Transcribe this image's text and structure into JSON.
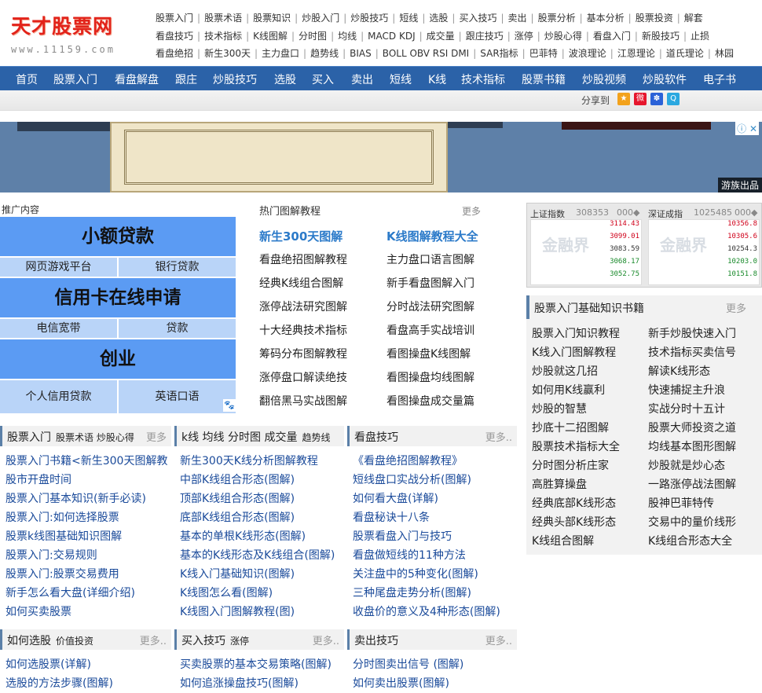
{
  "site": {
    "logo_text": "天才股票网",
    "logo_url": "www.11159.com"
  },
  "top_links": {
    "row1": [
      "股票入门",
      "股票术语",
      "股票知识",
      "炒股入门",
      "炒股技巧",
      "短线",
      "选股",
      "买入技巧",
      "卖出",
      "股票分析",
      "基本分析",
      "股票投资",
      "解套"
    ],
    "row2": [
      "看盘技巧",
      "技术指标",
      "K线图解",
      "分时图",
      "均线",
      "MACD KDJ",
      "成交量",
      "跟庄技巧",
      "涨停",
      "炒股心得",
      "看盘入门",
      "新股技巧",
      "止损"
    ],
    "row3": [
      "看盘绝招",
      "新生300天",
      "主力盘口",
      "趋势线",
      "BIAS",
      "BOLL OBV RSI DMI",
      "SAR指标",
      "巴菲特",
      "波浪理论",
      "江恩理论",
      "道氏理论",
      "林园"
    ]
  },
  "nav": [
    "首页",
    "股票入门",
    "看盘解盘",
    "跟庄",
    "炒股技巧",
    "选股",
    "买入",
    "卖出",
    "短线",
    "K线",
    "技术指标",
    "股票书籍",
    "炒股视频",
    "炒股软件",
    "电子书"
  ],
  "share": {
    "label": "分享到"
  },
  "banner": {
    "ad_info": "ⓘ ✕",
    "ad_label": "游族出品"
  },
  "promo": {
    "label": "推广内容",
    "big1": "小额贷款",
    "row1": [
      "网页游戏平台",
      "银行贷款"
    ],
    "big2": "信用卡在线申请",
    "row2": [
      "电信宽带",
      "贷款"
    ],
    "big3": "创业",
    "row3": [
      "个人信用贷款",
      "英语口语"
    ]
  },
  "hot": {
    "title": "热门图解教程",
    "more": "更多",
    "featured": [
      "新生300天图解",
      "K线图解教程大全"
    ],
    "left": [
      "看盘绝招图解教程",
      "经典K线组合图解",
      "涨停战法研究图解",
      "十大经典技术指标",
      "筹码分布图解教程",
      "涨停盘口解读绝技",
      "翻倍黑马实战图解"
    ],
    "right": [
      "主力盘口语言图解",
      "新手看盘图解入门",
      "分时战法研究图解",
      "看盘高手实战培训",
      "看图操盘K线图解",
      "看图操盘均线图解",
      "看图操盘成交量篇"
    ]
  },
  "quotes": {
    "sh": {
      "name": "上证指数",
      "value": "308353",
      "chg": "000◆",
      "levels": [
        "3114.43",
        "3099.01",
        "3083.59",
        "3068.17",
        "3052.75"
      ],
      "wm": "金融界"
    },
    "sz": {
      "name": "深证成指",
      "value": "1025485",
      "chg": "000◆",
      "levels": [
        "10356.8",
        "10305.6",
        "10254.3",
        "10203.0",
        "10151.8"
      ],
      "wm": "金融界"
    }
  },
  "books": {
    "title": "股票入门基础知识书籍",
    "more": "更多",
    "left": [
      "股票入门知识教程",
      "K线入门图解教程",
      "炒股就这几招",
      "如何用K线赢利",
      "炒股的智慧",
      "抄底十二招图解",
      "股票技术指标大全",
      "分时图分析庄家",
      "高胜算操盘",
      "经典底部K线形态",
      "经典头部K线形态",
      "K线组合图解"
    ],
    "right": [
      "新手炒股快速入门",
      "技术指标买卖信号",
      "解读K线形态",
      "快速捕捉主升浪",
      "实战分时十五计",
      "股票大师投资之道",
      "均线基本图形图解",
      "炒股就是炒心态",
      "一路涨停战法图解",
      "股神巴菲特传",
      "交易中的量价线形",
      "K线组合形态大全"
    ]
  },
  "panels": {
    "p1": {
      "title": "股票入门",
      "sub": "股票术语  炒股心得",
      "more": "更多",
      "items": [
        "股票入门书籍<新生300天图解教",
        "股市开盘时间",
        "股票入门基本知识(新手必读)",
        "股票入门:如何选择股票",
        "股票k线图基础知识图解",
        "股票入门:交易规则",
        "股票入门:股票交易费用",
        "新手怎么看大盘(详细介绍)",
        "如何买卖股票"
      ]
    },
    "p2": {
      "title": "k线 均线 分时图 成交量",
      "sub": "趋势线",
      "more": "",
      "items": [
        "新生300天K线分析图解教程",
        "中部K线组合形态(图解)",
        "顶部K线组合形态(图解)",
        "底部K线组合形态(图解)",
        "基本的单根K线形态(图解)",
        "基本的K线形态及K线组合(图解)",
        "K线入门基础知识(图解)",
        "K线图怎么看(图解)",
        "K线图入门图解教程(图)"
      ]
    },
    "p3": {
      "title": "看盘技巧",
      "sub": "",
      "more": "更多..",
      "items": [
        "《看盘绝招图解教程》",
        "短线盘口实战分析(图解)",
        "如何看大盘(详解)",
        "看盘秘诀十八条",
        "股票看盘入门与技巧",
        "看盘做短线的11种方法",
        "关注盘中的5种变化(图解)",
        "三种尾盘走势分析(图解)",
        "收盘价的意义及4种形态(图解)"
      ]
    },
    "p4": {
      "title": "如何选股",
      "sub": "价值投资",
      "more": "更多..",
      "items": [
        "如何选股票(详解)",
        "选股的方法步骤(图解)"
      ]
    },
    "p5": {
      "title": "买入技巧",
      "sub": "涨停",
      "more": "更多..",
      "items": [
        "买卖股票的基本交易策略(图解)",
        "如何追涨操盘技巧(图解)"
      ]
    },
    "p6": {
      "title": "卖出技巧",
      "sub": "",
      "more": "更多..",
      "items": [
        "分时图卖出信号 (图解)",
        "如何卖出股票(图解)"
      ]
    }
  },
  "colors": {
    "nav_bg": "#2b62a8",
    "promo_blue": "#5b9bf3",
    "promo_light": "#b9d4f8",
    "link_blue": "#1a4a9a",
    "logo_red": "#e2231a"
  }
}
